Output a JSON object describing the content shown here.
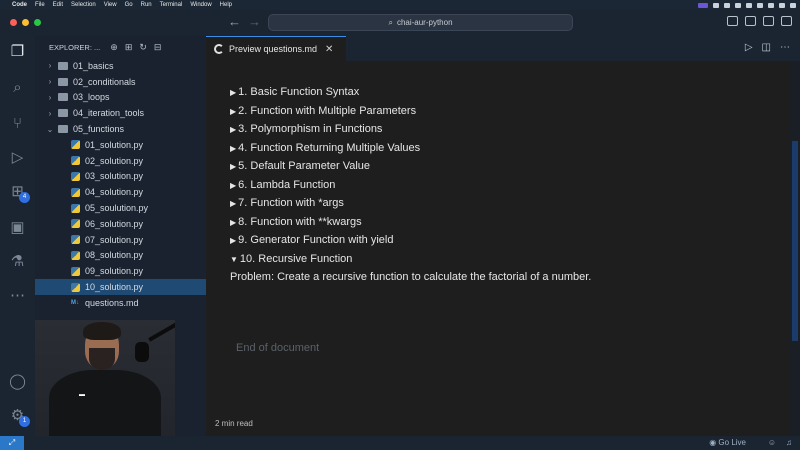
{
  "menubar": {
    "app": "Code",
    "menus": [
      "File",
      "Edit",
      "Selection",
      "View",
      "Go",
      "Run",
      "Terminal",
      "Window",
      "Help"
    ]
  },
  "titlebar": {
    "search": "chai-aur-python"
  },
  "activity_bar": {
    "extensions_badge": "4",
    "settings_badge": "1"
  },
  "explorer": {
    "title": "EXPLORER: ...",
    "folders": [
      "01_basics",
      "02_conditionals",
      "03_loops",
      "04_iteration_tools",
      "05_functions"
    ],
    "files": [
      "01_solution.py",
      "02_solution.py",
      "03_solution.py",
      "04_solution.py",
      "05_soulution.py",
      "06_solution.py",
      "07_solution.py",
      "08_solution.py",
      "09_solution.py",
      "10_solution.py"
    ],
    "md_file": "questions.md",
    "md_label": "M↓"
  },
  "editor": {
    "tab_label": "Preview questions.md",
    "items": [
      "1. Basic Function Syntax",
      "2. Function with Multiple Parameters",
      "3. Polymorphism in Functions",
      "4. Function Returning Multiple Values",
      "5. Default Parameter Value",
      "6. Lambda Function",
      "7. Function with *args",
      "8. Function with **kwargs",
      "9. Generator Function with yield",
      "10. Recursive Function"
    ],
    "problem": "Problem: Create a recursive function to calculate the factorial of a number.",
    "end_of_document": "End of document",
    "read_time": "2 min read"
  },
  "statusbar": {
    "go_live": "Go Live"
  },
  "colors": {
    "accent": "#3a8ee6",
    "selected_row": "#1e4a74",
    "remote": "#2b78c8"
  }
}
